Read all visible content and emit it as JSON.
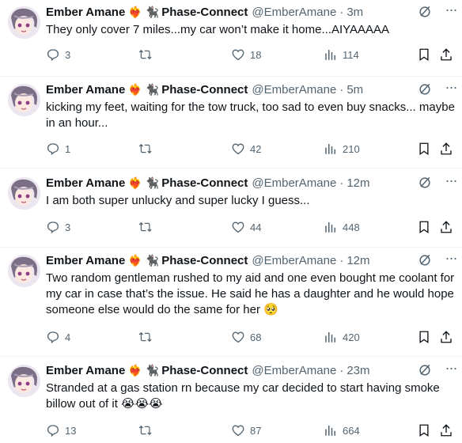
{
  "user": {
    "name": "Ember Amane",
    "badge_emoji": "❤️‍🔥",
    "affiliation_emoji": "🐈‍⬛",
    "affiliation": "Phase-Connect",
    "handle": "@EmberAmane"
  },
  "tweets": [
    {
      "time": "3m",
      "text": "They only cover 7 miles...my car won’t make it home...AIYAAAAA",
      "replies": "3",
      "likes": "18",
      "views": "114"
    },
    {
      "time": "5m",
      "text": "kicking my feet, waiting for the tow truck, too sad to even buy snacks... maybe in an hour...",
      "replies": "1",
      "likes": "42",
      "views": "210"
    },
    {
      "time": "12m",
      "text": "I am both super unlucky and super lucky I guess...",
      "replies": "3",
      "likes": "44",
      "views": "448"
    },
    {
      "time": "12m",
      "text": "Two random gentleman rushed to my aid and one even bought me coolant for my car in case that’s the issue. He said he has a daughter and he would hope someone else would do the same for her 🥺",
      "replies": "4",
      "likes": "68",
      "views": "420"
    },
    {
      "time": "23m",
      "text": "Stranded at a gas station rn because my car decided to start having smoke billow out of it 😭😭😭",
      "replies": "13",
      "likes": "87",
      "views": "664"
    }
  ],
  "icons": {
    "reply": "reply-icon",
    "retweet": "retweet-icon",
    "like": "like-icon",
    "views": "views-icon",
    "bookmark": "bookmark-icon",
    "share": "share-icon",
    "grok": "grok-icon",
    "more": "more-icon"
  },
  "colors": {
    "text": "#0f1419",
    "secondary": "#536471",
    "divider": "#eff3f4"
  }
}
